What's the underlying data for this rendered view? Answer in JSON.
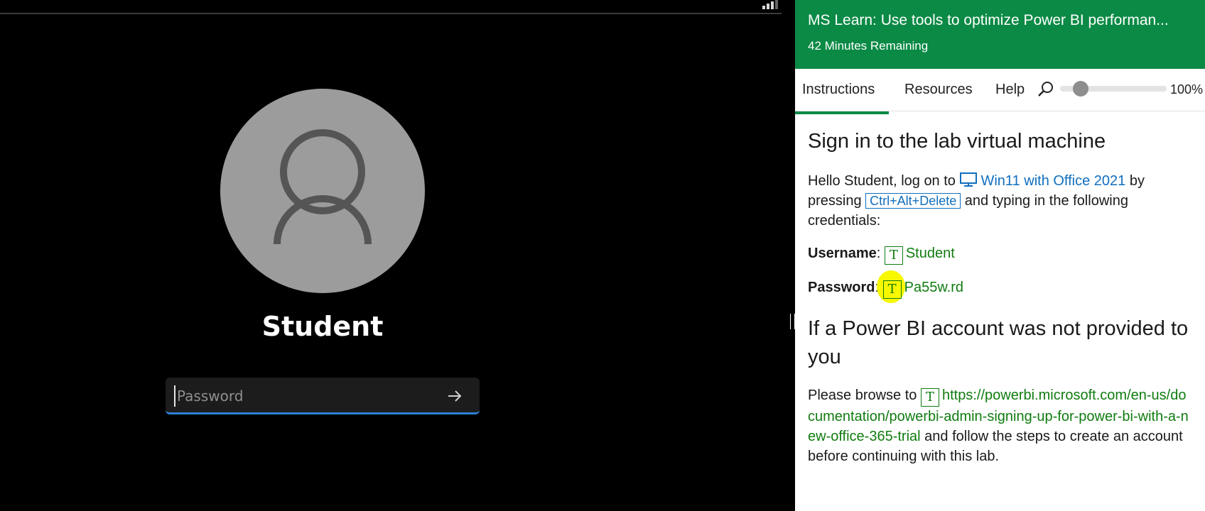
{
  "vm": {
    "username": "Student",
    "password_placeholder": "Password"
  },
  "panel": {
    "title": "MS Learn: Use tools to optimize Power BI performan...",
    "time_remaining": "42 Minutes Remaining",
    "tabs": [
      {
        "label": "Instructions",
        "active": true
      },
      {
        "label": "Resources",
        "active": false
      },
      {
        "label": "Help",
        "active": false
      }
    ],
    "zoom": {
      "level_percent": 100,
      "label": "100%"
    },
    "accent_color": "#0b8a45"
  },
  "content": {
    "heading1": "Sign in to the lab virtual machine",
    "intro_prefix": "Hello Student, log on to",
    "vm_link": "Win11 with Office 2021",
    "intro_by": "by pressing",
    "key_combo": "Ctrl+Alt+Delete",
    "intro_suffix": "and typing in the following credentials:",
    "username_label": "Username",
    "username_value": "Student",
    "password_label": "Password",
    "password_value": "Pa55w.rd",
    "type_button_glyph": "T",
    "heading2": "If a Power BI account was not provided to you",
    "browse_prefix": "Please browse to",
    "browse_url": "https://powerbi.microsoft.com/en-us/documentation/powerbi-admin-signing-up-for-power-bi-with-a-new-office-365-trial",
    "browse_suffix": "and follow the steps to create an account before continuing with this lab."
  }
}
